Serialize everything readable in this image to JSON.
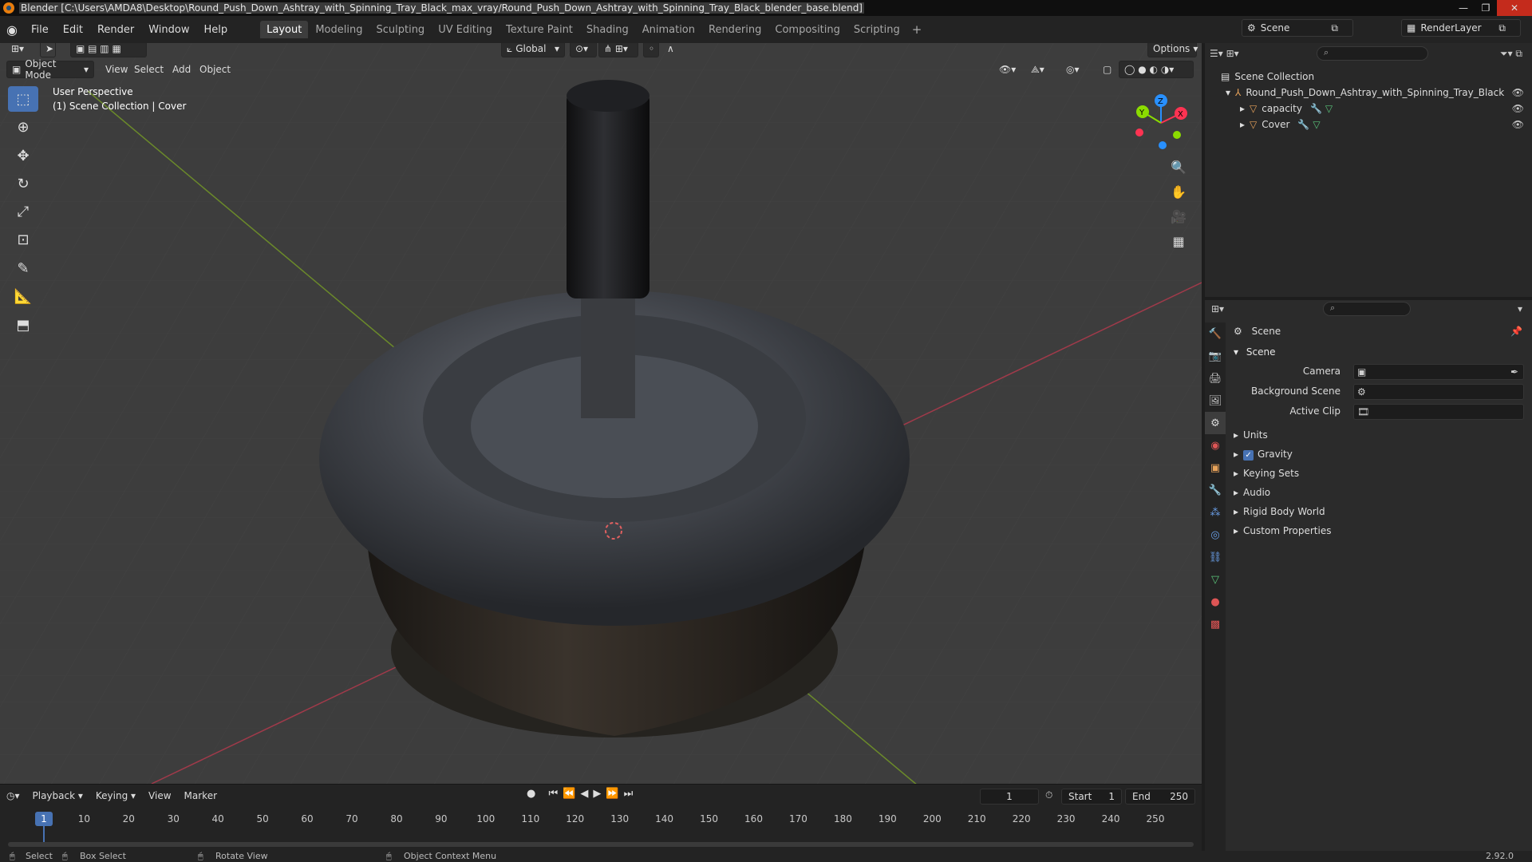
{
  "window": {
    "title": "Blender [C:\\Users\\AMDA8\\Desktop\\Round_Push_Down_Ashtray_with_Spinning_Tray_Black_max_vray/Round_Push_Down_Ashtray_with_Spinning_Tray_Black_blender_base.blend]"
  },
  "menu": [
    "File",
    "Edit",
    "Render",
    "Window",
    "Help"
  ],
  "workspaces": [
    "Layout",
    "Modeling",
    "Sculpting",
    "UV Editing",
    "Texture Paint",
    "Shading",
    "Animation",
    "Rendering",
    "Compositing",
    "Scripting"
  ],
  "active_workspace": "Layout",
  "scene_selector": "Scene",
  "layer_selector": "RenderLayer",
  "viewport": {
    "mode": "Object Mode",
    "menus": [
      "View",
      "Select",
      "Add",
      "Object"
    ],
    "transform_orientation": "Global",
    "options": "Options",
    "perspective": "User Perspective",
    "collection_info": "(1) Scene Collection | Cover",
    "gizmo": {
      "x": "X",
      "y": "Y",
      "z": "Z"
    }
  },
  "timeline": {
    "menus": [
      "Playback",
      "Keying",
      "View",
      "Marker"
    ],
    "current_frame": "1",
    "start_label": "Start",
    "start": "1",
    "end_label": "End",
    "end": "250",
    "ticks": [
      "1",
      "10",
      "20",
      "30",
      "40",
      "50",
      "60",
      "70",
      "80",
      "90",
      "100",
      "110",
      "120",
      "130",
      "140",
      "150",
      "160",
      "170",
      "180",
      "190",
      "200",
      "210",
      "220",
      "230",
      "240",
      "250"
    ]
  },
  "status": {
    "select": "Select",
    "box_select": "Box Select",
    "rotate": "Rotate View",
    "context": "Object Context Menu",
    "version": "2.92.0"
  },
  "outliner": {
    "root": "Scene Collection",
    "items": [
      {
        "name": "Round_Push_Down_Ashtray_with_Spinning_Tray_Black"
      },
      {
        "name": "capacity"
      },
      {
        "name": "Cover"
      }
    ]
  },
  "properties": {
    "header": "Scene",
    "section": "Scene",
    "fields": [
      {
        "label": "Camera"
      },
      {
        "label": "Background Scene"
      },
      {
        "label": "Active Clip"
      }
    ],
    "panels": [
      "Units",
      "Gravity",
      "Keying Sets",
      "Audio",
      "Rigid Body World",
      "Custom Properties"
    ]
  },
  "colors": {
    "accent": "#4772b3",
    "x_axis": "#ff3352",
    "y_axis": "#8bdc00",
    "z_axis": "#2890ff",
    "orange": "#e87d0d"
  }
}
